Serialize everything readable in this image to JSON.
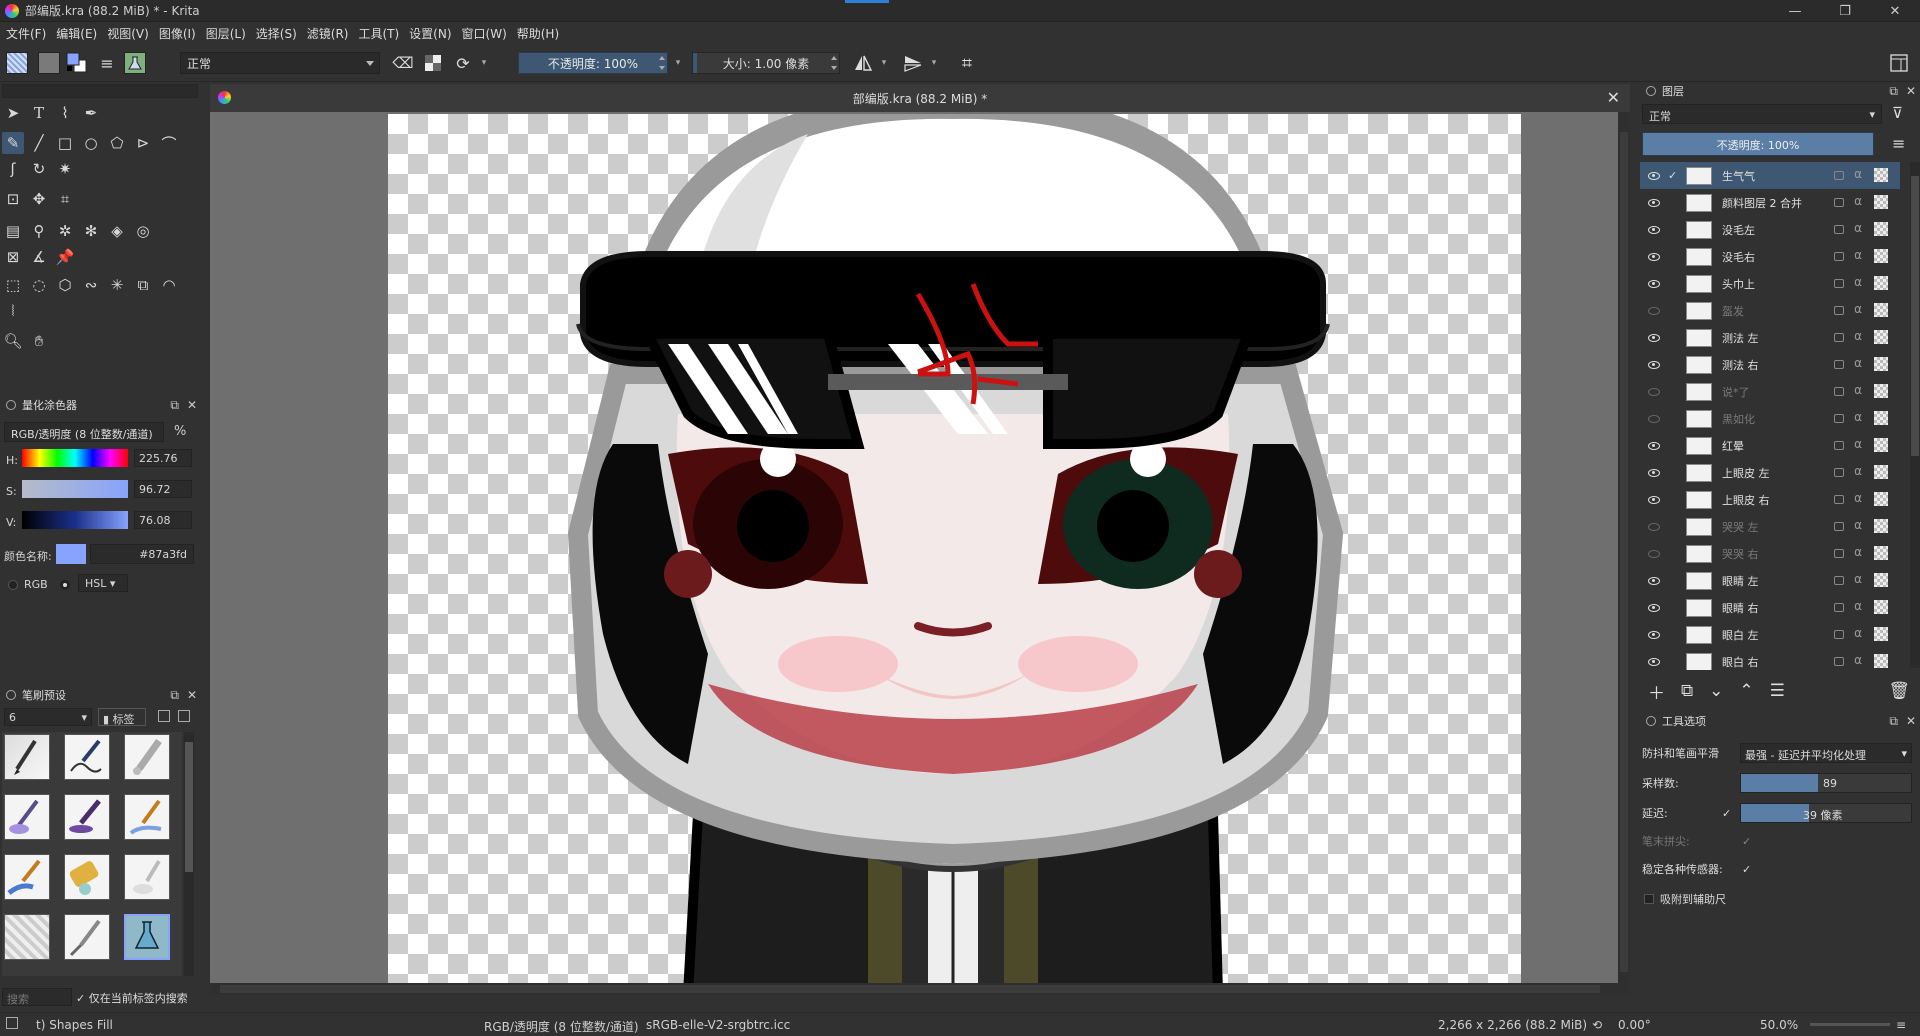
{
  "window": {
    "title": "部编版.kra (88.2 MiB) * - Krita",
    "controls": {
      "minimize": "—",
      "maximize": "❐",
      "close": "✕"
    }
  },
  "menu": [
    "文件(F)",
    "编辑(E)",
    "视图(V)",
    "图像(I)",
    "图层(L)",
    "选择(S)",
    "滤镜(R)",
    "工具(T)",
    "设置(N)",
    "窗口(W)",
    "帮助(H)"
  ],
  "toolbar": {
    "blend_mode": "正常",
    "opacity": "不透明度: 100%",
    "size": "大小: 1.00 像素"
  },
  "color_selector": {
    "title": "量化涂色器",
    "model": "RGB/透明度 (8 位整数/通道)",
    "percent_symbol": "%",
    "h_label": "H:",
    "h_value": "225.76",
    "s_label": "S:",
    "s_value": "96.72",
    "v_label": "V:",
    "v_value": "76.08",
    "name_label": "颜色名称:",
    "hex": "#87a3fd",
    "mode_rgb": "RGB",
    "mode_hsl": "HSL"
  },
  "brush_presets": {
    "title": "笔刷预设",
    "filter_value": "6",
    "tag_label": "标签",
    "search_placeholder": "搜索",
    "search_in_tag": "仅在当前标签内搜索"
  },
  "canvas": {
    "tab_title": "部编版.kra (88.2 MiB) *"
  },
  "layers_panel": {
    "title": "图层",
    "blend_mode": "正常",
    "opacity": "不透明度: 100%",
    "layers": [
      {
        "name": "生气气",
        "visible": true,
        "selected": true
      },
      {
        "name": "颜料图层 2 合并",
        "visible": true,
        "selected": false
      },
      {
        "name": "没毛左",
        "visible": true,
        "selected": false
      },
      {
        "name": "没毛右",
        "visible": true,
        "selected": false
      },
      {
        "name": "头巾上",
        "visible": true,
        "selected": false
      },
      {
        "name": "盔发",
        "visible": false,
        "selected": false
      },
      {
        "name": "测法 左",
        "visible": true,
        "selected": false
      },
      {
        "name": "测法 右",
        "visible": true,
        "selected": false
      },
      {
        "name": "说*了",
        "visible": false,
        "selected": false
      },
      {
        "name": "黑如化",
        "visible": false,
        "selected": false
      },
      {
        "name": "红晕",
        "visible": true,
        "selected": false
      },
      {
        "name": "上眼皮 左",
        "visible": true,
        "selected": false
      },
      {
        "name": "上眼皮 右",
        "visible": true,
        "selected": false
      },
      {
        "name": "哭哭 左",
        "visible": false,
        "selected": false
      },
      {
        "name": "哭哭 右",
        "visible": false,
        "selected": false
      },
      {
        "name": "眼睛 左",
        "visible": true,
        "selected": false
      },
      {
        "name": "眼睛 右",
        "visible": true,
        "selected": false
      },
      {
        "name": "眼白 左",
        "visible": true,
        "selected": false
      },
      {
        "name": "眼白 右",
        "visible": true,
        "selected": false
      }
    ]
  },
  "tool_options": {
    "title": "工具选项",
    "smoothing_label": "防抖和笔画平滑",
    "smoothing_value": "最强 - 延迟并平均化处理",
    "samples_label": "采样数:",
    "samples_value": "89",
    "samples_fill": 0.45,
    "delay_label": "延迟:",
    "delay_value": "39 像素",
    "delay_fill": 0.4,
    "finish_label": "笔末拼尖:",
    "stabilize_label": "稳定各种传感器:",
    "snap_label": "吸附到辅助尺"
  },
  "status": {
    "tool": "t) Shapes Fill",
    "colorspace": "RGB/透明度 (8 位整数/通道)",
    "profile": "sRGB-elle-V2-srgbtrc.icc",
    "dimensions": "2,266 x 2,266 (88.2 MiB)",
    "rotation": "0.00°",
    "zoom": "50.0%"
  },
  "colors": {
    "accent": "#3e5874",
    "fg_color": "#87a3fd"
  }
}
